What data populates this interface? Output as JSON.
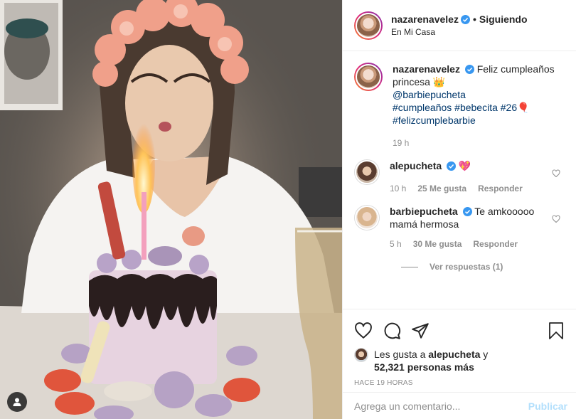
{
  "post": {
    "author": "nazarenavelez",
    "follow_label": "Siguiendo",
    "location": "En Mi Casa"
  },
  "caption": {
    "author": "nazarenavelez",
    "text": "Feliz cumpleaños princesa 👑",
    "mention": "@barbiepucheta",
    "hashtags_line1": "#cumpleaños #bebecita #26🎈",
    "hashtags_line2": "#felizcumplebarbie",
    "time": "19 h"
  },
  "comments": [
    {
      "author": "alepucheta",
      "text": "💖",
      "time": "10 h",
      "likes": "25 Me gusta",
      "reply": "Responder"
    },
    {
      "author": "barbiepucheta",
      "text": "Te amkooooo mamá hermosa",
      "time": "5 h",
      "likes": "30 Me gusta",
      "reply": "Responder"
    }
  ],
  "replies_label": "Ver respuestas (1)",
  "likes": {
    "prefix": "Les gusta a ",
    "user": "alepucheta",
    "suffix": " y",
    "count_text": "52,321 personas más"
  },
  "timestamp": "HACE 19 HORAS",
  "comment_box": {
    "placeholder": "Agrega un comentario...",
    "publish_label": "Publicar"
  },
  "colors": {
    "link": "#00376b",
    "muted": "#8e8e8e",
    "verified": "#3897f0",
    "publish_disabled": "#b2dffc"
  },
  "icons": [
    "heart-icon",
    "comment-icon",
    "share-icon",
    "bookmark-icon",
    "verified-badge-icon",
    "user-tag-icon"
  ]
}
